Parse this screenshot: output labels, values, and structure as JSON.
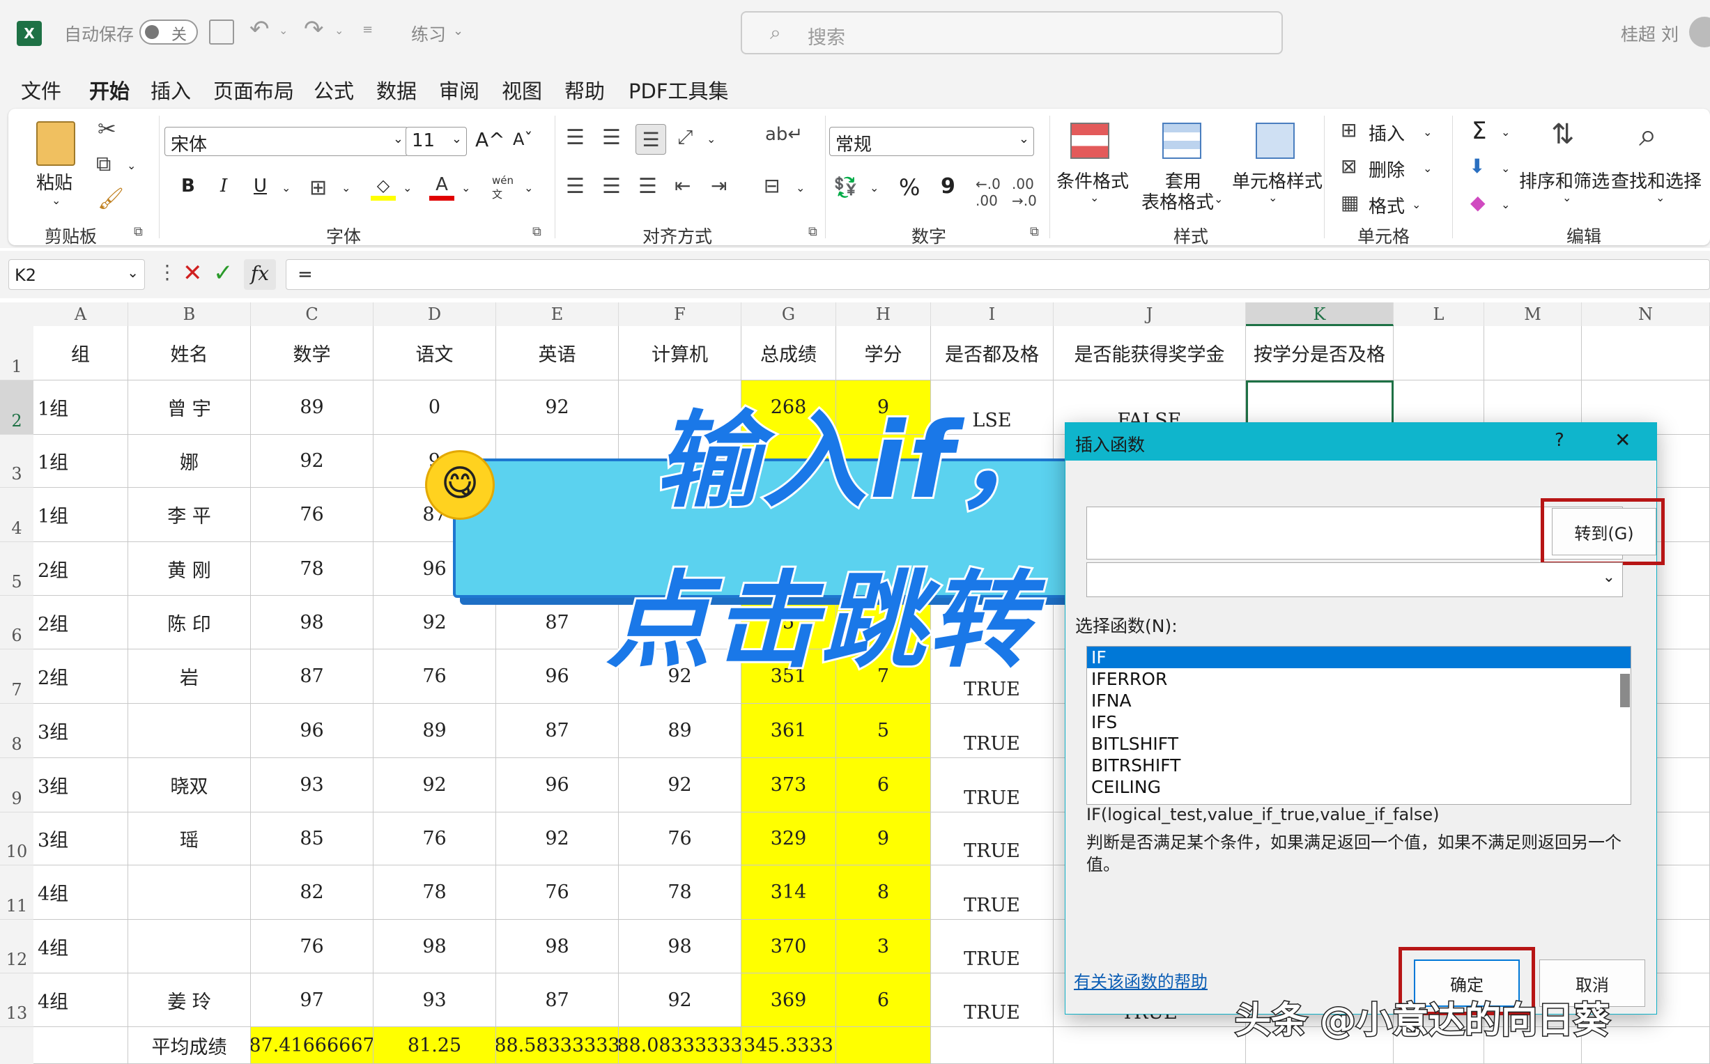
{
  "titlebar": {
    "autosave_label": "自动保存",
    "autosave_state": "关",
    "doc_name": "练习",
    "search_placeholder": "搜索",
    "user_name": "桂超 刘"
  },
  "menu": [
    "文件",
    "开始",
    "插入",
    "页面布局",
    "公式",
    "数据",
    "审阅",
    "视图",
    "帮助",
    "PDF工具集"
  ],
  "ribbon": {
    "clipboard": {
      "paste": "粘贴",
      "label": "剪贴板"
    },
    "font": {
      "name": "宋体",
      "size": "11",
      "bold": "B",
      "italic": "I",
      "underline": "U",
      "label": "字体",
      "grow": "A^",
      "shrink": "Aˇ",
      "wen": "wén文"
    },
    "align": {
      "label": "对齐方式"
    },
    "number": {
      "format": "常规",
      "label": "数字",
      "percent": "%",
      "comma": "9"
    },
    "styles": {
      "cond": "条件格式",
      "table_line1": "套用",
      "table_line2": "表格格式",
      "cell": "单元格样式",
      "label": "样式"
    },
    "cells": {
      "insert": "插入",
      "delete": "删除",
      "format": "格式",
      "label": "单元格"
    },
    "edit": {
      "sort": "排序和筛选",
      "find": "查找和选择",
      "label": "编辑",
      "sigma": "Σ"
    }
  },
  "formula_bar": {
    "name_box": "K2",
    "formula": "="
  },
  "columns": [
    "A",
    "B",
    "C",
    "D",
    "E",
    "F",
    "G",
    "H",
    "I",
    "J",
    "K",
    "L",
    "M",
    "N"
  ],
  "row_numbers": [
    "1",
    "2",
    "3",
    "4",
    "5",
    "6",
    "7",
    "8",
    "9",
    "10",
    "11",
    "12",
    "13"
  ],
  "headers": [
    "组",
    "姓名",
    "数学",
    "语文",
    "英语",
    "计算机",
    "总成绩",
    "学分",
    "是否都及格",
    "是否能获得奖学金",
    "按学分是否及格"
  ],
  "rows": [
    [
      "1组",
      "曾  宇",
      "89",
      "0",
      "92",
      "",
      "268",
      "9",
      "LSE",
      "FALSE"
    ],
    [
      "1组",
      "  娜",
      "92",
      "9",
      "",
      "",
      "",
      "",
      "",
      ""
    ],
    [
      "1组",
      "李  平",
      "76",
      "87",
      "",
      "",
      "",
      "",
      "",
      ""
    ],
    [
      "2组",
      "黄  刚",
      "78",
      "96",
      "",
      "",
      "",
      "",
      "",
      ""
    ],
    [
      "2组",
      "陈  印",
      "98",
      "92",
      "87",
      "",
      "5",
      "",
      "",
      ""
    ],
    [
      "2组",
      "  岩",
      "87",
      "76",
      "96",
      "92",
      "351",
      "7",
      "TRUE",
      ""
    ],
    [
      "3组",
      "  ",
      "96",
      "89",
      "87",
      "89",
      "361",
      "5",
      "TRUE",
      ""
    ],
    [
      "3组",
      "  晓双",
      "93",
      "92",
      "96",
      "92",
      "373",
      "6",
      "TRUE",
      ""
    ],
    [
      "3组",
      "  瑶",
      "85",
      "76",
      "92",
      "76",
      "329",
      "9",
      "TRUE",
      ""
    ],
    [
      "4组",
      "  ",
      "82",
      "78",
      "76",
      "78",
      "314",
      "8",
      "TRUE",
      ""
    ],
    [
      "4组",
      "  ",
      "76",
      "98",
      "98",
      "98",
      "370",
      "3",
      "TRUE",
      ""
    ],
    [
      "4组",
      "姜  玲",
      "97",
      "93",
      "87",
      "92",
      "369",
      "6",
      "TRUE",
      "TRUE"
    ]
  ],
  "avg_row": {
    "label": "平均成绩",
    "values": [
      "87.41666667",
      "81.25",
      "88.58333333",
      "88.08333333",
      "345.3333"
    ]
  },
  "dialog": {
    "title": "插入函数",
    "help_q": "?",
    "close": "✕",
    "goto_btn": "转到(G)",
    "select_label": "选择函数(N):",
    "functions": [
      "IF",
      "IFERROR",
      "IFNA",
      "IFS",
      "BITLSHIFT",
      "BITRSHIFT",
      "CEILING"
    ],
    "selected_index": 0,
    "signature": "IF(logical_test,value_if_true,value_if_false)",
    "description": "判断是否满足某个条件，如果满足返回一个值，如果不满足则返回另一个值。",
    "help_link": "有关该函数的帮助",
    "ok": "确定",
    "cancel": "取消"
  },
  "overlay": {
    "line1": "输入if，",
    "line2": "点击跳转",
    "watermark": "头条 @小意达的向日葵"
  },
  "colors": {
    "accent": "#1e7145",
    "highlight": "#ffff00",
    "dialog_title": "#0fb5cc",
    "banner": "#5bd2ef",
    "red_box": "#b71515"
  }
}
